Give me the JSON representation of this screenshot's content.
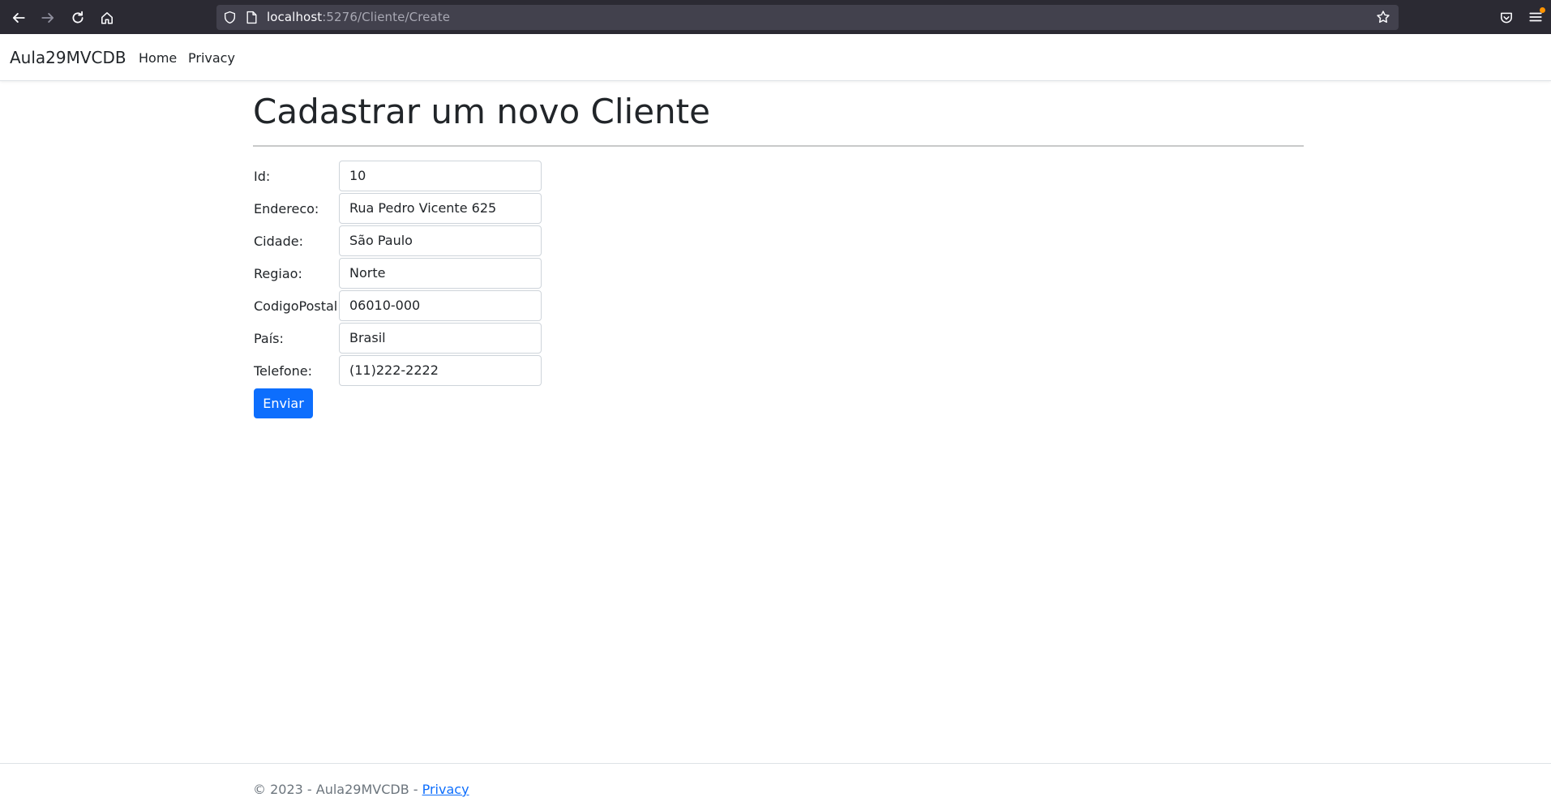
{
  "browser": {
    "url_host": "localhost",
    "url_path": ":5276/Cliente/Create",
    "icons": [
      "back-arrow-icon",
      "forward-arrow-icon",
      "reload-icon",
      "home-icon",
      "shield-icon",
      "page-icon",
      "star-icon",
      "pocket-icon",
      "menu-icon"
    ]
  },
  "navbar": {
    "brand": "Aula29MVCDB",
    "links": [
      "Home",
      "Privacy"
    ]
  },
  "main": {
    "title": "Cadastrar um novo Cliente",
    "fields": [
      {
        "label": "Id:",
        "value": "10"
      },
      {
        "label": "Endereco:",
        "value": "Rua Pedro Vicente 625"
      },
      {
        "label": "Cidade:",
        "value": "São Paulo"
      },
      {
        "label": "Regiao:",
        "value": "Norte"
      },
      {
        "label": "CodigoPostal:",
        "value": "06010-000"
      },
      {
        "label": "País:",
        "value": "Brasil"
      },
      {
        "label": "Telefone:",
        "value": "(11)222-2222"
      }
    ],
    "submit_label": "Enviar"
  },
  "footer": {
    "text": "© 2023 - Aula29MVCDB - ",
    "link": "Privacy"
  },
  "colors": {
    "primary": "#0d6efd",
    "browser_chrome": "#2b2a33",
    "url_bar": "#42414d",
    "text": "#212529",
    "muted": "#6c757d"
  }
}
